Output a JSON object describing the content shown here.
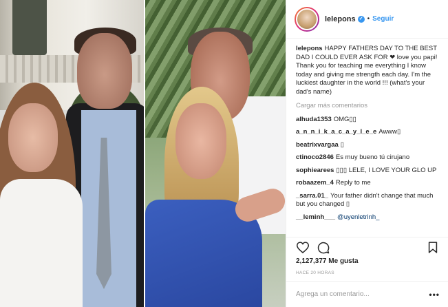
{
  "post": {
    "username": "lelepons",
    "follow_label": "Seguir",
    "caption_text": "HAPPY FATHERS DAY TO THE BEST DAD I COULD EVER ASK FOR ❤ love you papi! Thank you for teaching me everything I know today and giving me strength each day. I'm the luckiest daughter in the world !!! (what's your dad's name)",
    "load_more_label": "Cargar más comentarios",
    "comments": [
      {
        "user": "alhuda1353",
        "text": "OMG▯▯"
      },
      {
        "user": "a_n_n_i_k_a_c_a_y_l_e_e",
        "text": "Awww▯"
      },
      {
        "user": "beatrixvargaa",
        "text": "▯"
      },
      {
        "user": "ctinoco2846",
        "text": "Es muy bueno tú cirujano"
      },
      {
        "user": "sophiearees",
        "text": "▯▯▯ LELE, I LOVE YOUR GLO UP"
      },
      {
        "user": "robaazem_4",
        "text": "Reply to me"
      },
      {
        "user": "_sarra.01_",
        "text": "Your father didn't change that much but you changed ▯"
      },
      {
        "user": "__leminh___",
        "text": "@uyenletrinh_"
      }
    ],
    "likes_count": "2,127,377",
    "likes_label": "Me gusta",
    "time_ago": "HACE 20 HORAS",
    "add_comment_placeholder": "Agrega un comentario...",
    "more_options": "•••"
  },
  "icons": {
    "verified": "verified-badge-icon",
    "like": "heart-icon",
    "comment": "speech-bubble-icon",
    "save": "bookmark-icon"
  },
  "colors": {
    "accent": "#3897f0",
    "text": "#262626",
    "muted": "#999999",
    "border": "#efefef"
  }
}
